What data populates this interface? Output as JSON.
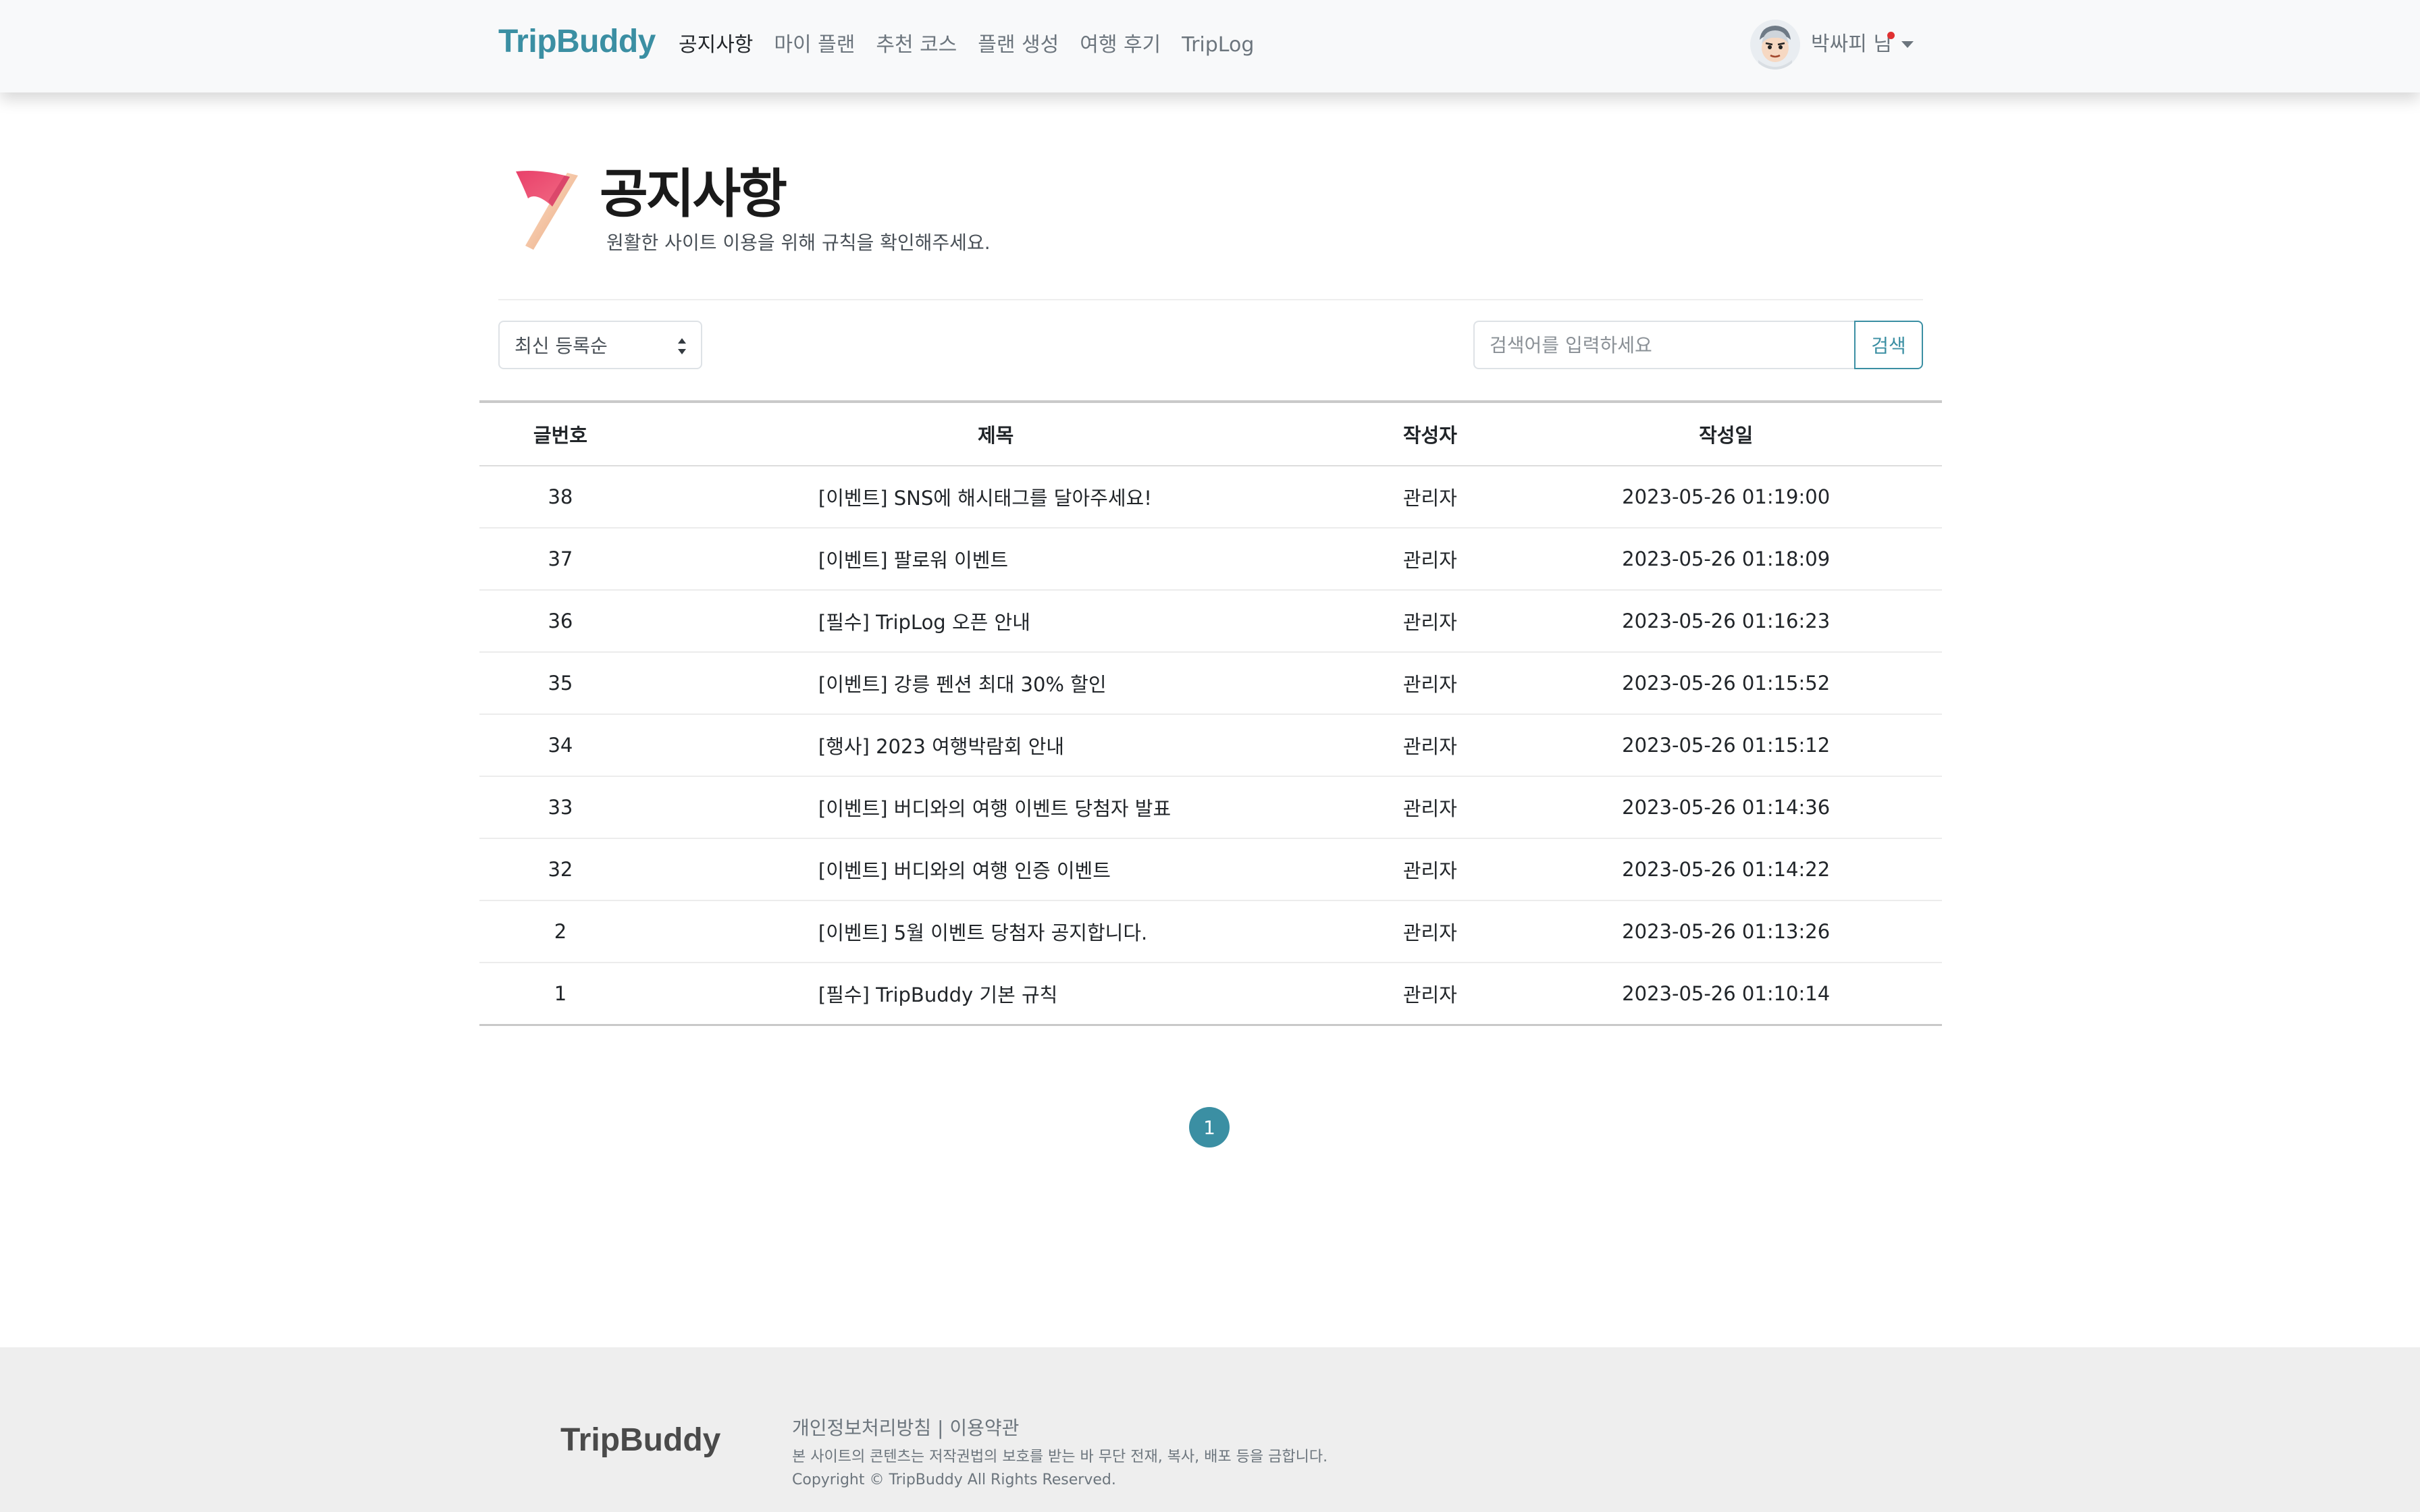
{
  "navbar": {
    "brand": "TripBuddy",
    "links": [
      "공지사항",
      "마이 플랜",
      "추천 코스",
      "플랜 생성",
      "여행 후기",
      "TripLog"
    ],
    "active_link": "공지사항",
    "user_name": "박싸피 님",
    "avatar_icon": "avatar-icon",
    "notification_color": "#e03131"
  },
  "header": {
    "icon": "flag-icon",
    "title": "공지사항",
    "subtitle": "원활한 사이트 이용을 위해 규칙을 확인해주세요."
  },
  "filters": {
    "sort_selected": "최신 등록순",
    "search_placeholder": "검색어를 입력하세요",
    "search_button": "검색"
  },
  "table": {
    "headers": [
      "글번호",
      "제목",
      "작성자",
      "작성일"
    ],
    "rows": [
      {
        "no": "38",
        "title": "[이벤트] SNS에 해시태그를 달아주세요!",
        "author": "관리자",
        "date": "2023-05-26 01:19:00"
      },
      {
        "no": "37",
        "title": "[이벤트] 팔로워 이벤트",
        "author": "관리자",
        "date": "2023-05-26 01:18:09"
      },
      {
        "no": "36",
        "title": "[필수] TripLog 오픈 안내",
        "author": "관리자",
        "date": "2023-05-26 01:16:23"
      },
      {
        "no": "35",
        "title": "[이벤트] 강릉 펜션 최대 30% 할인",
        "author": "관리자",
        "date": "2023-05-26 01:15:52"
      },
      {
        "no": "34",
        "title": "[행사] 2023 여행박람회 안내",
        "author": "관리자",
        "date": "2023-05-26 01:15:12"
      },
      {
        "no": "33",
        "title": "[이벤트] 버디와의 여행 이벤트 당첨자 발표",
        "author": "관리자",
        "date": "2023-05-26 01:14:36"
      },
      {
        "no": "32",
        "title": "[이벤트] 버디와의 여행 인증 이벤트",
        "author": "관리자",
        "date": "2023-05-26 01:14:22"
      },
      {
        "no": "2",
        "title": "[이벤트] 5월 이벤트 당첨자 공지합니다.",
        "author": "관리자",
        "date": "2023-05-26 01:13:26"
      },
      {
        "no": "1",
        "title": "[필수] TripBuddy 기본 규칙",
        "author": "관리자",
        "date": "2023-05-26 01:10:14"
      }
    ]
  },
  "pagination": {
    "current_page": "1"
  },
  "footer": {
    "brand": "TripBuddy",
    "links": "개인정보처리방침 | 이용약관",
    "notice": "본 사이트의 콘텐츠는 저작권법의 보호를 받는 바 무단 전재, 복사, 배포 등을 금합니다.",
    "copyright": "Copyright © TripBuddy All Rights Reserved."
  },
  "colors": {
    "brand": "#3b8fa3",
    "footer_bg": "#eeeeee",
    "navbar_bg": "#f8f9fa"
  }
}
